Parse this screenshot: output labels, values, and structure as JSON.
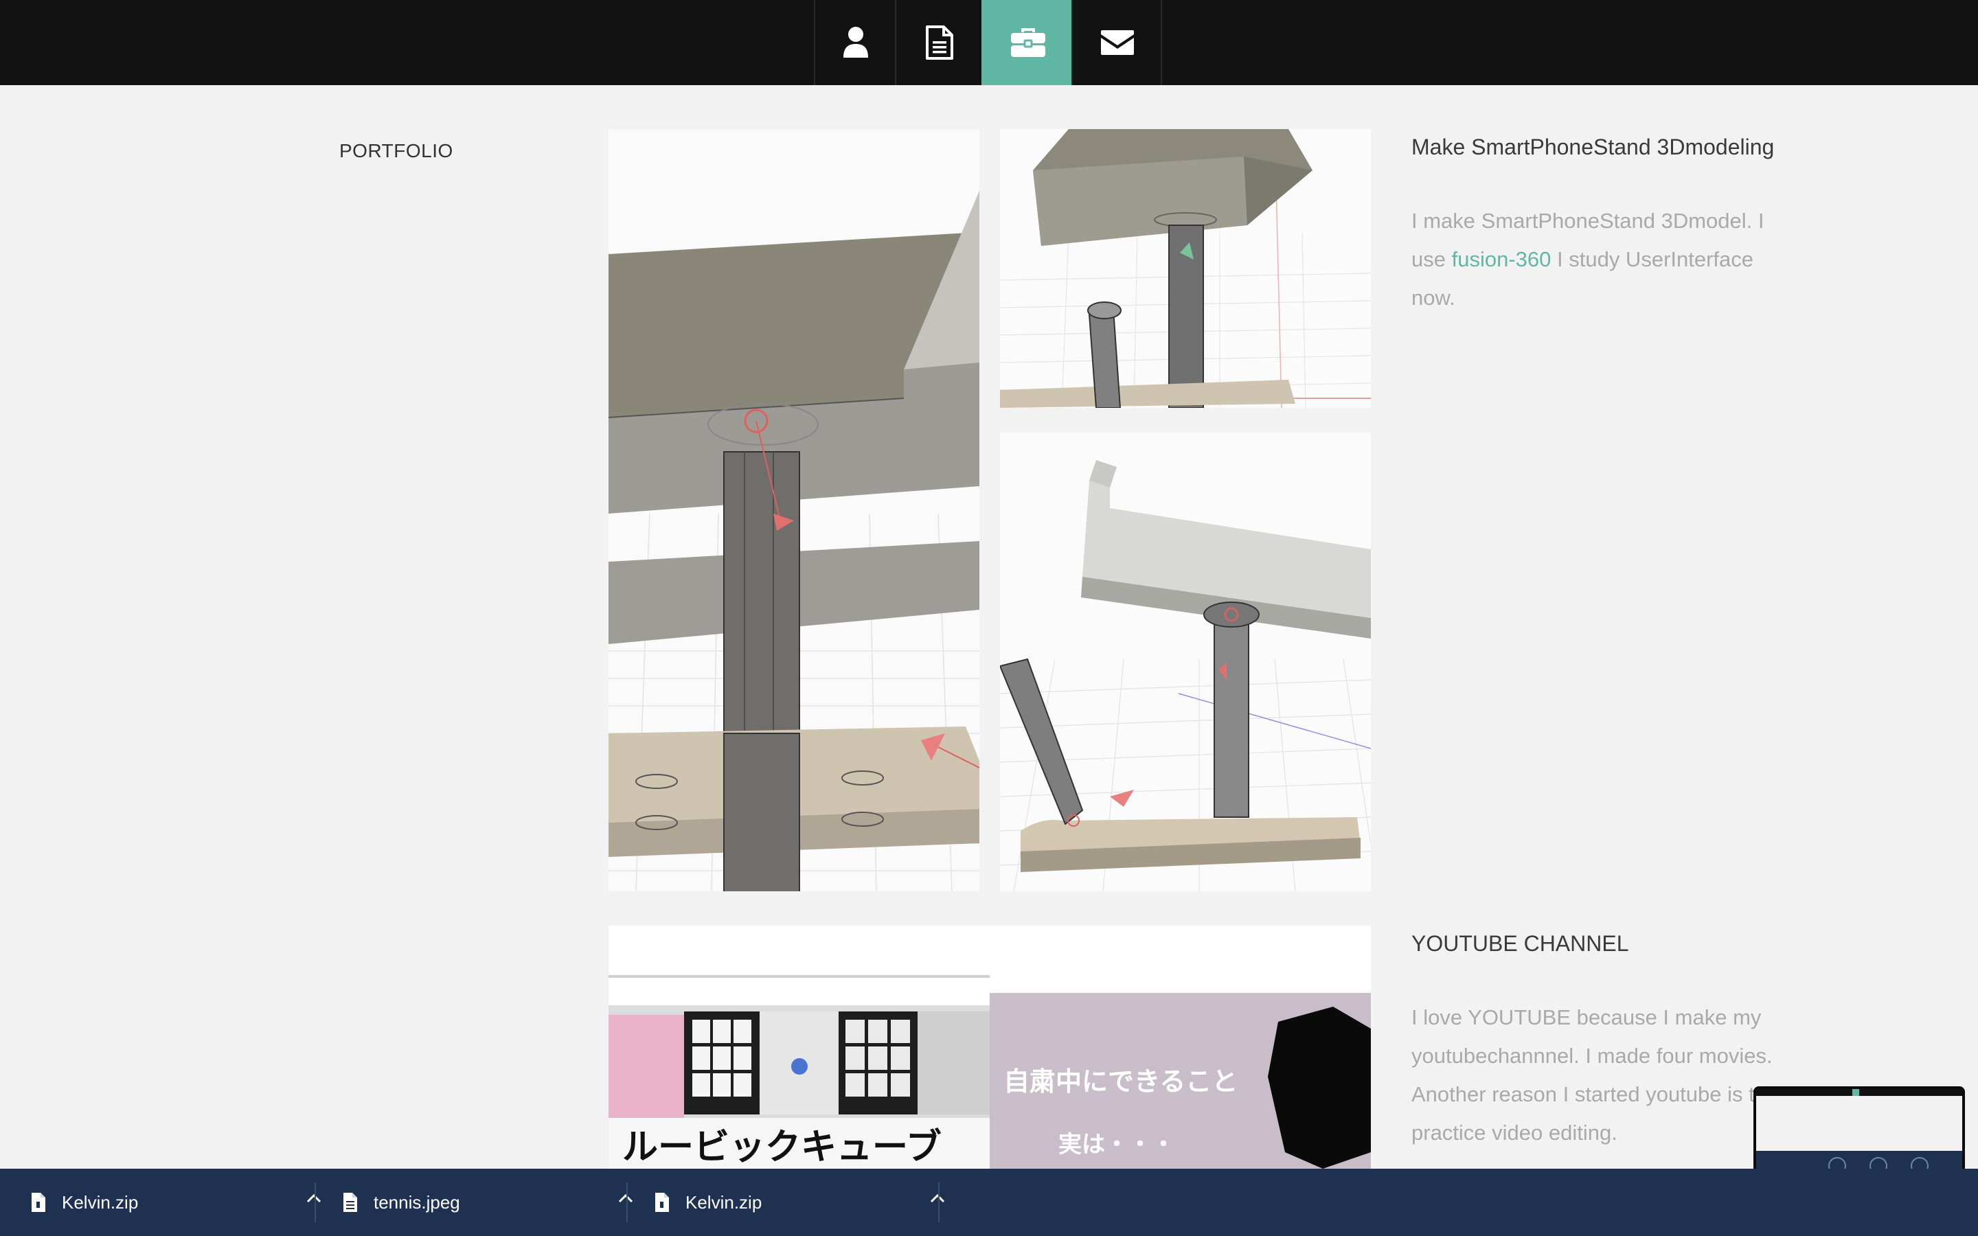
{
  "nav": {
    "items": [
      {
        "icon": "user-icon",
        "active": false
      },
      {
        "icon": "resume-icon",
        "active": false
      },
      {
        "icon": "briefcase-icon",
        "active": true
      },
      {
        "icon": "envelope-icon",
        "active": false
      }
    ],
    "active_color": "#5fb7a4"
  },
  "section": {
    "label": "PORTFOLIO"
  },
  "projects": [
    {
      "title": "Make SmartPhoneStand 3Dmodeling",
      "desc_before": "I make SmartPhoneStand 3Dmodel. I use ",
      "link": "fusion-360",
      "desc_after": " I study UserInterface now."
    },
    {
      "title": "YOUTUBE CHANNEL",
      "desc": "I love YOUTUBE because I make my youtubechannnel. I made four movies. Another reason I started youtube is to practice video editing.",
      "thumb_left_text": "ルービックキューブ",
      "thumb_right_line1": "自粛中にできること",
      "thumb_right_line2": "実は・・・"
    }
  ],
  "downloads": [
    {
      "name": "Kelvin.zip",
      "icon": "zip-file-icon"
    },
    {
      "name": "tennis.jpeg",
      "icon": "image-file-icon"
    },
    {
      "name": "Kelvin.zip",
      "icon": "zip-file-icon"
    }
  ]
}
